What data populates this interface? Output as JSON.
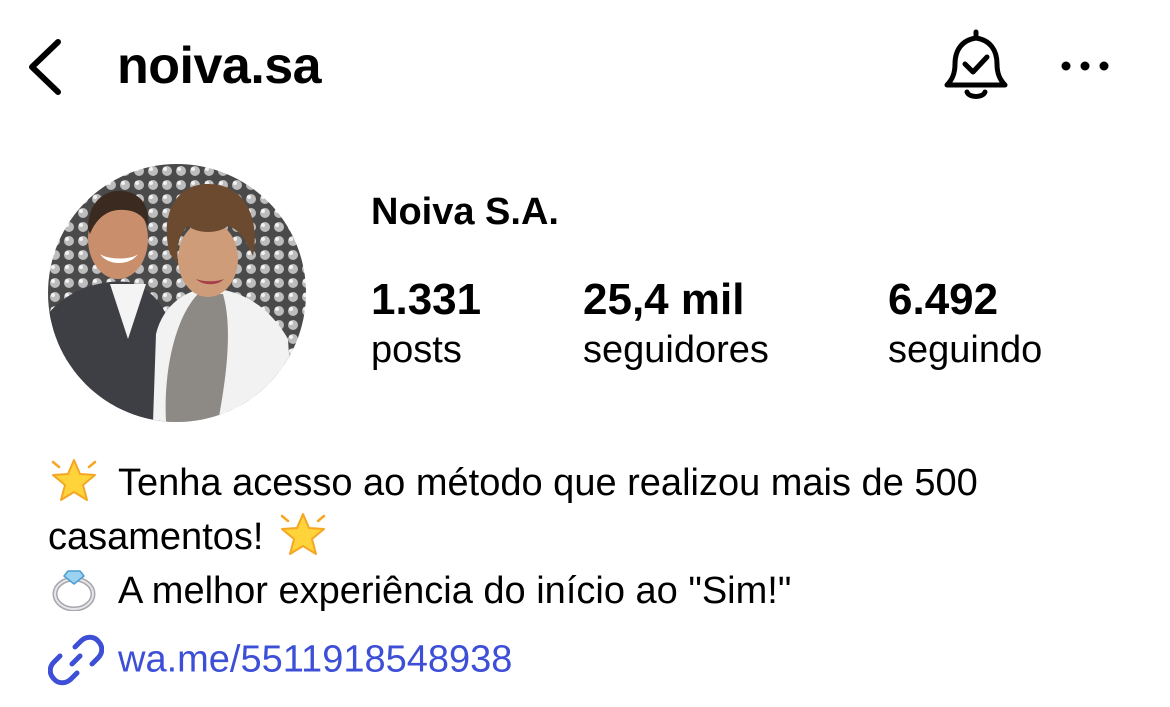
{
  "header": {
    "username": "noiva.sa"
  },
  "profile": {
    "display_name": "Noiva S.A.",
    "stats": {
      "posts": {
        "value": "1.331",
        "label": "posts"
      },
      "followers": {
        "value": "25,4 mil",
        "label": "seguidores"
      },
      "following": {
        "value": "6.492",
        "label": "seguindo"
      }
    }
  },
  "bio": {
    "line1": "Tenha acesso ao método que realizou mais de 500",
    "line2": "casamentos!",
    "line3": "A melhor experiência do início ao \"Sim!\""
  },
  "link": {
    "text": "wa.me/5511918548938"
  },
  "colors": {
    "link": "#3d4fd6",
    "text": "#000000",
    "background": "#ffffff"
  },
  "icons": {
    "back": "chevron-left-icon",
    "notifications": "bell-check-icon",
    "more": "more-horizontal-icon",
    "star": "glowing-star-emoji",
    "ring": "ring-emoji",
    "link": "link-icon"
  }
}
